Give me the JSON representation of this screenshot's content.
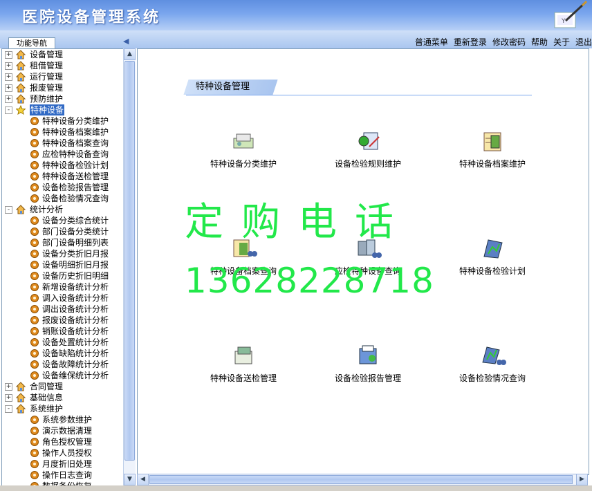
{
  "app": {
    "title": "医院设备管理系统"
  },
  "nav": {
    "panel_tab": "功能导航",
    "links": [
      "普通菜单",
      "重新登录",
      "修改密码",
      "帮助",
      "关于",
      "退出"
    ]
  },
  "tree": [
    {
      "label": "设备管理",
      "level": 0,
      "expander": "+",
      "icon": "house"
    },
    {
      "label": "租借管理",
      "level": 0,
      "expander": "+",
      "icon": "house"
    },
    {
      "label": "运行管理",
      "level": 0,
      "expander": "+",
      "icon": "house"
    },
    {
      "label": "报废管理",
      "level": 0,
      "expander": "+",
      "icon": "house"
    },
    {
      "label": "预防维护",
      "level": 0,
      "expander": "+",
      "icon": "house"
    },
    {
      "label": "特种设备",
      "level": 0,
      "expander": "-",
      "icon": "star",
      "selected": true
    },
    {
      "label": "特种设备分类维护",
      "level": 1,
      "icon": "gear"
    },
    {
      "label": "特种设备档案维护",
      "level": 1,
      "icon": "gear"
    },
    {
      "label": "特种设备档案查询",
      "level": 1,
      "icon": "gear"
    },
    {
      "label": "应检特种设备查询",
      "level": 1,
      "icon": "gear"
    },
    {
      "label": "特种设备检验计划",
      "level": 1,
      "icon": "gear"
    },
    {
      "label": "特种设备送检管理",
      "level": 1,
      "icon": "gear"
    },
    {
      "label": "设备检验报告管理",
      "level": 1,
      "icon": "gear"
    },
    {
      "label": "设备检验情况查询",
      "level": 1,
      "icon": "gear"
    },
    {
      "label": "统计分析",
      "level": 0,
      "expander": "-",
      "icon": "house"
    },
    {
      "label": "设备分类综合统计",
      "level": 1,
      "icon": "gear"
    },
    {
      "label": "部门设备分类统计",
      "level": 1,
      "icon": "gear"
    },
    {
      "label": "部门设备明细列表",
      "level": 1,
      "icon": "gear"
    },
    {
      "label": "设备分类折旧月报",
      "level": 1,
      "icon": "gear"
    },
    {
      "label": "设备明细折旧月报",
      "level": 1,
      "icon": "gear"
    },
    {
      "label": "设备历史折旧明细",
      "level": 1,
      "icon": "gear"
    },
    {
      "label": "新增设备统计分析",
      "level": 1,
      "icon": "gear"
    },
    {
      "label": "调入设备统计分析",
      "level": 1,
      "icon": "gear"
    },
    {
      "label": "调出设备统计分析",
      "level": 1,
      "icon": "gear"
    },
    {
      "label": "报废设备统计分析",
      "level": 1,
      "icon": "gear"
    },
    {
      "label": "销账设备统计分析",
      "level": 1,
      "icon": "gear"
    },
    {
      "label": "设备处置统计分析",
      "level": 1,
      "icon": "gear"
    },
    {
      "label": "设备缺陷统计分析",
      "level": 1,
      "icon": "gear"
    },
    {
      "label": "设备故障统计分析",
      "level": 1,
      "icon": "gear"
    },
    {
      "label": "设备维保统计分析",
      "level": 1,
      "icon": "gear"
    },
    {
      "label": "合同管理",
      "level": 0,
      "expander": "+",
      "icon": "house"
    },
    {
      "label": "基础信息",
      "level": 0,
      "expander": "+",
      "icon": "house"
    },
    {
      "label": "系统维护",
      "level": 0,
      "expander": "-",
      "icon": "house"
    },
    {
      "label": "系统参数维护",
      "level": 1,
      "icon": "gear"
    },
    {
      "label": "演示数据清理",
      "level": 1,
      "icon": "gear"
    },
    {
      "label": "角色授权管理",
      "level": 1,
      "icon": "gear"
    },
    {
      "label": "操作人员授权",
      "level": 1,
      "icon": "gear"
    },
    {
      "label": "月度折旧处理",
      "level": 1,
      "icon": "gear"
    },
    {
      "label": "操作日志查询",
      "level": 1,
      "icon": "gear"
    },
    {
      "label": "数据备份恢复",
      "level": 1,
      "icon": "gear"
    }
  ],
  "main": {
    "section_title": "特种设备管理",
    "tiles": [
      {
        "label": "特种设备分类维护",
        "icon": "category-icon"
      },
      {
        "label": "设备检验规则维护",
        "icon": "rules-icon"
      },
      {
        "label": "特种设备档案维护",
        "icon": "archive-icon"
      },
      {
        "label": "特种设备档案查询",
        "icon": "archive-search-icon"
      },
      {
        "label": "应检特种设备查询",
        "icon": "device-search-icon"
      },
      {
        "label": "特种设备检验计划",
        "icon": "plan-icon"
      },
      {
        "label": "特种设备送检管理",
        "icon": "send-inspection-icon"
      },
      {
        "label": "设备检验报告管理",
        "icon": "report-icon"
      },
      {
        "label": "设备检验情况查询",
        "icon": "inspection-search-icon"
      }
    ]
  },
  "watermark": {
    "line1": "定购电话",
    "line2": "13628228718"
  },
  "colors": {
    "header": "#6f9ae6",
    "selection": "#316ac5",
    "watermark": "#22e84a"
  }
}
